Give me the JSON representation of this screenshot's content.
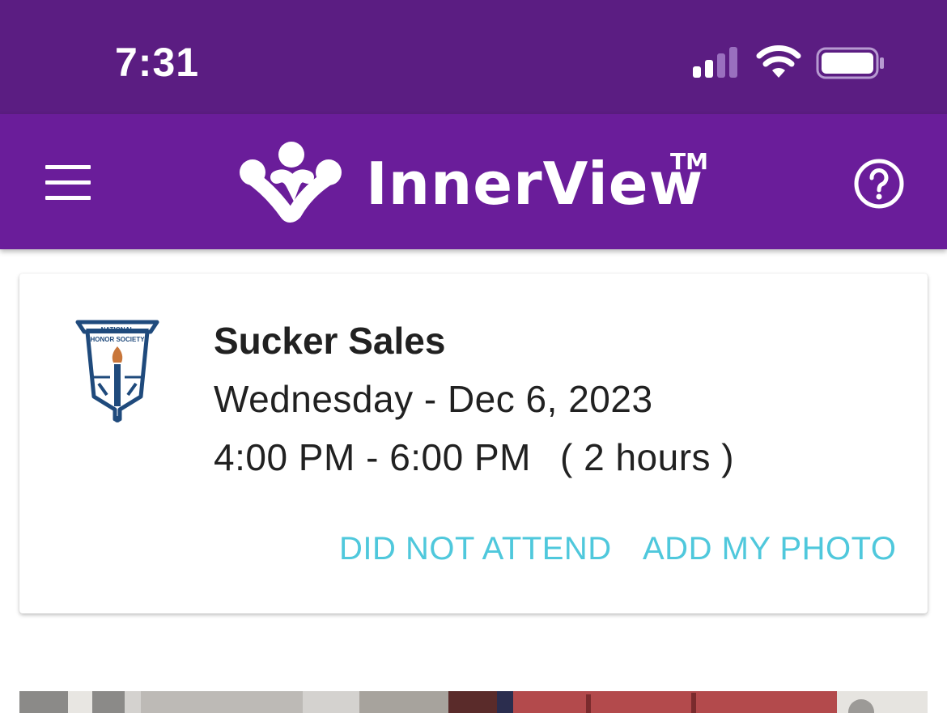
{
  "status_bar": {
    "time": "7:31",
    "icons": [
      "cellular-signal-icon",
      "wifi-icon",
      "battery-icon"
    ]
  },
  "header": {
    "brand_name": "InnerView",
    "brand_tm": "TM",
    "menu_icon": "hamburger-menu-icon",
    "help_icon": "help-circle-icon",
    "colors": {
      "status_bar": "#5b1d82",
      "header": "#6a1d9a"
    }
  },
  "event": {
    "logo_text_line1": "NATIONAL",
    "logo_text_line2": "HONOR SOCIETY",
    "title": "Sucker Sales",
    "date": "Wednesday - Dec 6, 2023",
    "time_range": "4:00 PM - 6:00 PM",
    "duration": "( 2 hours )",
    "actions": {
      "did_not_attend": "DID NOT ATTEND",
      "add_my_photo": "ADD MY PHOTO"
    },
    "action_color": "#4fc8dc"
  }
}
